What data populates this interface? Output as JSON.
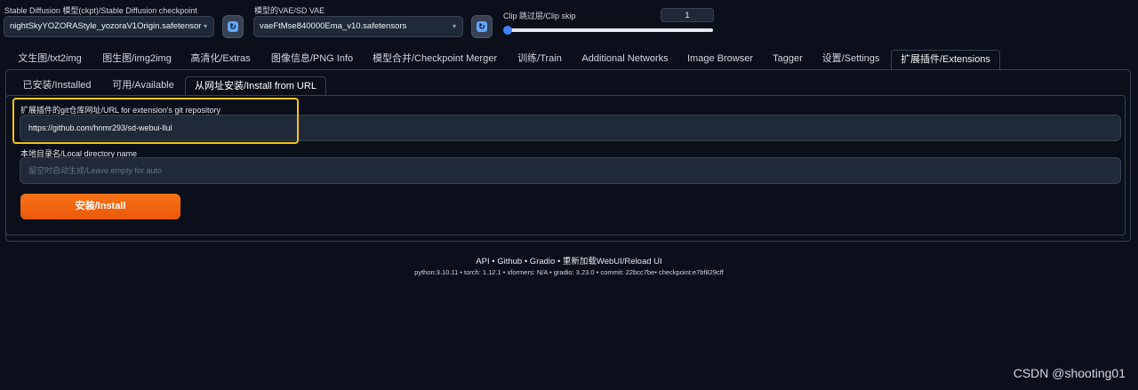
{
  "header": {
    "checkpoint_label": "Stable Diffusion 模型(ckpt)/Stable Diffusion checkpoint",
    "checkpoint_value": "nightSkyYOZORAStyle_yozoraV1Origin.safetensor",
    "vae_label": "模型的VAE/SD VAE",
    "vae_value": "vaeFtMse840000Ema_v10.safetensors",
    "clip_label": "Clip 跳过层/Clip skip",
    "clip_value": "1"
  },
  "tabs": [
    "文生图/txt2img",
    "图生图/img2img",
    "高清化/Extras",
    "图像信息/PNG Info",
    "模型合并/Checkpoint Merger",
    "训练/Train",
    "Additional Networks",
    "Image Browser",
    "Tagger",
    "设置/Settings",
    "扩展插件/Extensions"
  ],
  "subtabs": [
    "已安装/Installed",
    "可用/Available",
    "从网址安装/Install from URL"
  ],
  "form": {
    "url_label": "扩展插件的git仓库网址/URL for extension's git repository",
    "url_value": "https://github.com/hnmr293/sd-webui-llul",
    "dir_label": "本地目录名/Local directory name",
    "dir_placeholder": "留空时自动生成/Leave empty for auto",
    "install_label": "安装/Install"
  },
  "footer": {
    "links": "API  •  Github  •  Gradio  •  重新加载WebUI/Reload UI",
    "versions": "python:3.10.11  •  torch: 1.12.1  •  xformers: N/A  •  gradio: 3.23.0  •  commit: 22bcc7be•  checkpoint:e7bf829cff"
  },
  "watermark": "CSDN @shooting01",
  "colors": {
    "background": "#0b0f19",
    "accent_orange": "#f97316",
    "highlight_yellow": "#f5c518",
    "slider_blue": "#3b82f6"
  }
}
